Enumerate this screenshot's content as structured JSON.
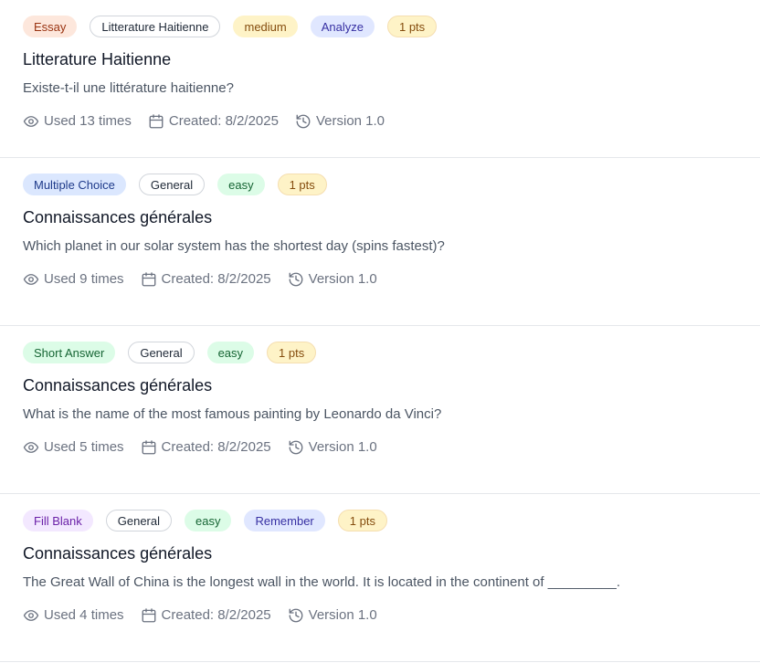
{
  "questions": [
    {
      "type_label": "Essay",
      "subject_label": "Litterature Haitienne",
      "difficulty_label": "medium",
      "bloom_label": "Analyze",
      "points_label": "1 pts",
      "title": "Litterature Haitienne",
      "text": "Existe-t-il une littérature haitienne?",
      "usage": "Used 13 times",
      "created": "Created: 8/2/2025",
      "version": "Version 1.0"
    },
    {
      "type_label": "Multiple Choice",
      "subject_label": "General",
      "difficulty_label": "easy",
      "points_label": "1 pts",
      "title": "Connaissances générales",
      "text": "Which planet in our solar system has the shortest day (spins fastest)?",
      "usage": "Used 9 times",
      "created": "Created: 8/2/2025",
      "version": "Version 1.0"
    },
    {
      "type_label": "Short Answer",
      "subject_label": "General",
      "difficulty_label": "easy",
      "points_label": "1 pts",
      "title": "Connaissances générales",
      "text": "What is the name of the most famous painting by Leonardo da Vinci?",
      "usage": "Used 5 times",
      "created": "Created: 8/2/2025",
      "version": "Version 1.0"
    },
    {
      "type_label": "Fill Blank",
      "subject_label": "General",
      "difficulty_label": "easy",
      "bloom_label": "Remember",
      "points_label": "1 pts",
      "title": "Connaissances générales",
      "text": "The Great Wall of China is the longest wall in the world. It is located in the continent of _________.",
      "usage": "Used 4 times",
      "created": "Created: 8/2/2025",
      "version": "Version 1.0"
    }
  ],
  "icons": {
    "usage": "eye-icon",
    "created": "calendar-icon",
    "version": "history-icon"
  },
  "colors": {
    "essay_bg": "#fde7dc",
    "multiple_choice_bg": "#dbe7fe",
    "short_answer_bg": "#dcfce7",
    "fill_blank_bg": "#f3e8ff",
    "medium_bg": "#fef3c7",
    "easy_bg": "#dcfce7",
    "bloom_bg": "#e0e7ff",
    "points_bg": "#fef3c7"
  }
}
